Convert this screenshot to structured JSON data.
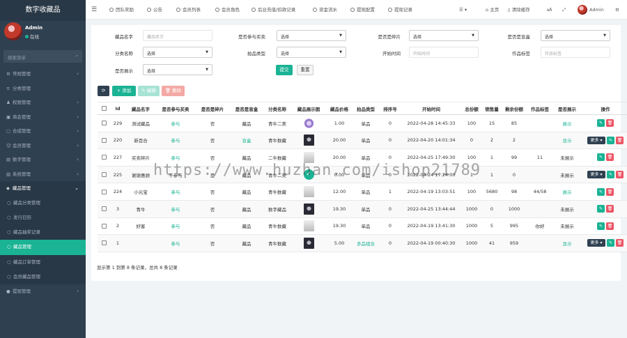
{
  "app": {
    "title": "数字收藏品",
    "user_name": "Admin",
    "user_status": "在线",
    "search_placeholder": "搜索菜单"
  },
  "sidebar": {
    "items": [
      {
        "icon": "gear-icon",
        "label": "常规管理"
      },
      {
        "icon": "list-icon",
        "label": "分类管理"
      },
      {
        "icon": "users-icon",
        "label": "权限管理"
      },
      {
        "icon": "cart-icon",
        "label": "商会管理"
      },
      {
        "icon": "bag-icon",
        "label": "合成管理"
      },
      {
        "icon": "user-icon",
        "label": "会员管理"
      },
      {
        "icon": "book-icon",
        "label": "数字管理"
      },
      {
        "icon": "file-icon",
        "label": "系统管理"
      },
      {
        "icon": "cube-icon",
        "label": "藏品管理"
      }
    ],
    "submenu": [
      "藏品分类管理",
      "发行日历",
      "藏品抽奖记录",
      "藏品管理",
      "藏品订单管理",
      "会员藏品管理"
    ],
    "active_sub": 3,
    "last_item": "提现管理"
  },
  "topbar": {
    "tabs": [
      "团队奖励",
      "公告",
      "会员列表",
      "会员角色",
      "后台充值/扣款记录",
      "资金流水",
      "提现配置",
      "提现记录"
    ],
    "home_label": "主页",
    "clear_cache": "清除缓存",
    "admin": "Admin"
  },
  "filters": {
    "name_label": "藏品名字",
    "name_placeholder": "藏品名字",
    "trade_label": "是否参与买卖",
    "trade_value": "选择",
    "fragment_label": "是否是碎片",
    "fragment_value": "选择",
    "blindbox_label": "是否是盲盒",
    "blindbox_value": "选择",
    "category_label": "分类名称",
    "category_value": "选择",
    "auction_label": "拍品类型",
    "auction_value": "选择",
    "start_label": "开始时间",
    "start_placeholder": "开始时间",
    "author_label": "作品标签",
    "author_placeholder": "作品标签",
    "display_label": "是否展示",
    "display_value": "选择",
    "submit": "提交",
    "reset": "重置"
  },
  "toolbar": {
    "refresh": "⟳",
    "add": "+ 添加",
    "edit": "✎ 编辑",
    "delete": "🗑 删除"
  },
  "table": {
    "headers": [
      "Id",
      "藏品名字",
      "是否参与买卖",
      "是否是碎片",
      "是否是盲盒",
      "分类名称",
      "藏品展示图",
      "藏品价格",
      "拍品类型",
      "排序号",
      "开始时间",
      "总份额",
      "销售量",
      "剩余份额",
      "作品标签",
      "是否展示",
      "操作"
    ],
    "rows": [
      {
        "id": "229",
        "name": "测试藏品",
        "trade": "参与",
        "fragment": "否",
        "blind": "藏品",
        "category": "青牛二美",
        "thumb": "gem",
        "price": "1.00",
        "auction": "单品",
        "sort": "0",
        "start": "2022-04-28 14:45:33",
        "total": "100",
        "sold": "15",
        "remain": "85",
        "tag": "",
        "display": "展示",
        "more": false
      },
      {
        "id": "220",
        "name": "新百合",
        "trade": "参与",
        "fragment": "否",
        "blind": "盲盒",
        "category": "青牛数藏",
        "thumb": "dark",
        "price": "20.00",
        "auction": "单品",
        "sort": "0",
        "start": "2022-04-20 14:01:34",
        "total": "0",
        "sold": "2",
        "remain": "2",
        "tag": "",
        "display": "显示",
        "more": true
      },
      {
        "id": "227",
        "name": "买卖碎片",
        "trade": "参与",
        "fragment": "否",
        "blind": "藏品",
        "category": "二牛数藏",
        "thumb": "white",
        "price": "20.00",
        "auction": "单品",
        "sort": "0",
        "start": "2022-04-25 17:49:30",
        "total": "100",
        "sold": "1",
        "remain": "99",
        "tag": "11",
        "display": "未展示",
        "more": false
      },
      {
        "id": "225",
        "name": "谢谢惠顾",
        "trade": "不参与",
        "fragment": "是",
        "blind": "藏品",
        "category": "青牛二美",
        "thumb": "check",
        "price": "0.00",
        "auction": "单品",
        "sort": "0",
        "start": "2022-04-24 17:24:00",
        "total": "1",
        "sold": "1",
        "remain": "0",
        "tag": "",
        "display": "未展示",
        "more": true
      },
      {
        "id": "224",
        "name": "小元宝",
        "trade": "参与",
        "fragment": "否",
        "blind": "藏品",
        "category": "青牛数藏",
        "thumb": "white",
        "price": "12.00",
        "auction": "单品",
        "sort": "1",
        "start": "2022-04-19 13:03:51",
        "total": "100",
        "sold": "5680",
        "remain": "98",
        "tag": "44/58",
        "display": "展示",
        "more": false
      },
      {
        "id": "3",
        "name": "青牛",
        "trade": "参与",
        "fragment": "否",
        "blind": "藏品",
        "category": "数字藏品",
        "thumb": "dark",
        "price": "19.30",
        "auction": "单品",
        "sort": "0",
        "start": "2022-04-25 13:44:44",
        "total": "1000",
        "sold": "0",
        "remain": "1000",
        "tag": "",
        "display": "未展示",
        "more": false
      },
      {
        "id": "2",
        "name": "好客",
        "trade": "参与",
        "fragment": "否",
        "blind": "藏品",
        "category": "青牛数藏",
        "thumb": "white",
        "price": "19.30",
        "auction": "单品",
        "sort": "0",
        "start": "2022-04-19 13:41:30",
        "total": "1000",
        "sold": "5",
        "remain": "995",
        "tag": "你好",
        "display": "未展示",
        "more": false
      },
      {
        "id": "1",
        "name": "",
        "trade": "参与",
        "fragment": "否",
        "blind": "藏品",
        "category": "青牛数藏",
        "thumb": "dark",
        "price": "5.00",
        "auction": "多品组合",
        "sort": "0",
        "start": "2022-04-19 00:40:30",
        "total": "1000",
        "sold": "41",
        "remain": "959",
        "tag": "",
        "display": "显示",
        "more": true
      }
    ],
    "more_label": "更多 ▾"
  },
  "pager": "显示第 1 到第 8 条记录，总共 8 条记录",
  "watermark": "https://www.huzhan.com/ishop21789",
  "colors": {
    "accent": "#1ab394",
    "sidebar": "#2f4050",
    "danger": "#ed5565"
  }
}
